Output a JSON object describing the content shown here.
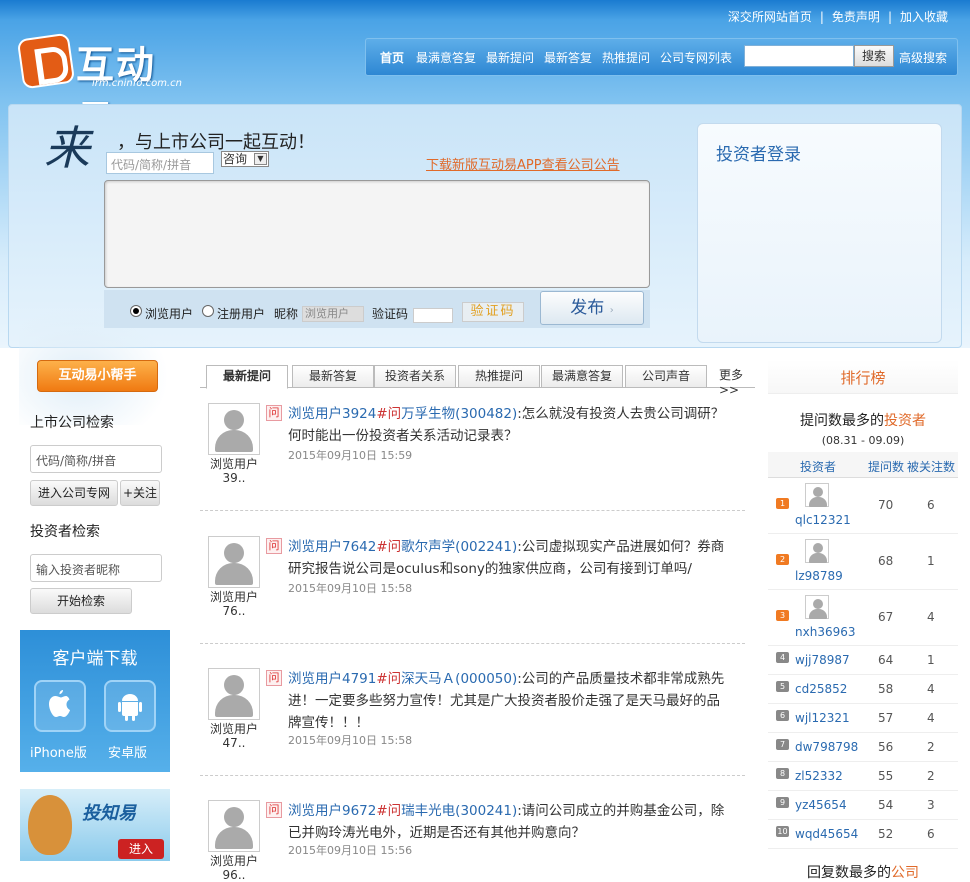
{
  "top_links": [
    "深交所网站首页",
    "免责声明",
    "加入收藏"
  ],
  "logo": {
    "name": "互动易",
    "url": "irm.cninfo.com.cn"
  },
  "nav": {
    "items": [
      "首页",
      "最满意答复",
      "最新提问",
      "最新答复",
      "热推提问",
      "公司专网列表"
    ],
    "search_button": "搜索",
    "advanced_search": "高级搜索"
  },
  "ask": {
    "lai": "来",
    "slogan": "，与上市公司一起互动！",
    "code_placeholder": "代码/简称/拼音",
    "type_value": "咨询",
    "app_link": "下载新版互动易APP查看公司公告",
    "radio_guest": "浏览用户",
    "radio_registered": "注册用户",
    "nick_label": "昵称",
    "nick_value": "浏览用户",
    "captcha_label": "验证码",
    "captcha_text": "验证码",
    "submit": "发布"
  },
  "login": {
    "title": "投资者登录"
  },
  "sidebar": {
    "helper": "互动易小帮手",
    "company_search_title": "上市公司检索",
    "company_placeholder": "代码/简称/拼音",
    "enter_button": "进入公司专网",
    "follow_button": "+关注",
    "investor_search_title": "投资者检索",
    "investor_placeholder": "输入投资者昵称",
    "start_search": "开始检索",
    "client_title": "客户端下载",
    "iphone": "iPhone版",
    "android": "安卓版",
    "touzhi_name": "投知易",
    "touzhi_enter": "进入"
  },
  "tabs": {
    "items": [
      "最新提问",
      "最新答复",
      "投资者关系",
      "热推提问",
      "最满意答复",
      "公司声音"
    ],
    "more": "更多>>"
  },
  "questions": [
    {
      "user": "浏览用户3924",
      "wen": "问",
      "company": "万孚生物(300482)",
      "text": ":怎么就没有投资人去贵公司调研？何时能出一份投资者关系活动记录表？",
      "time": "2015年09月10日 15:59",
      "avatar_user": "浏览用户",
      "avatar_sub": "39.."
    },
    {
      "user": "浏览用户7642",
      "wen": "问",
      "company": "歌尔声学(002241)",
      "text": ":公司虚拟现实产品进展如何？券商研究报告说公司是oculus和sony的独家供应商，公司有接到订单吗/",
      "time": "2015年09月10日 15:58",
      "avatar_user": "浏览用户",
      "avatar_sub": "76.."
    },
    {
      "user": "浏览用户4791",
      "wen": "问",
      "company": "深天马Ａ(000050)",
      "text": ":公司的产品质量技术都非常成熟先进！一定要多些努力宣传！尤其是广大投资者股价走强了是天马最好的品牌宣传！！！",
      "time": "2015年09月10日 15:58",
      "avatar_user": "浏览用户",
      "avatar_sub": "47.."
    },
    {
      "user": "浏览用户9672",
      "wen": "问",
      "company": "瑞丰光电(300241)",
      "text": ":请问公司成立的并购基金公司，除已并购玲涛光电外，近期是否还有其他并购意向？",
      "time": "2015年09月10日 15:56",
      "avatar_user": "浏览用户",
      "avatar_sub": "96.."
    }
  ],
  "ranking": {
    "title": "排行榜",
    "sub_prefix": "提问数最多的",
    "sub_highlight": "投资者",
    "date": "(08.31 - 09.09)",
    "col_investor": "投资者",
    "col_questions": "提问数",
    "col_follows": "被关注数",
    "rows": [
      {
        "rank": "1",
        "name": "qlc12321",
        "questions": "70",
        "follows": "6"
      },
      {
        "rank": "2",
        "name": "lz98789",
        "questions": "68",
        "follows": "1"
      },
      {
        "rank": "3",
        "name": "nxh36963",
        "questions": "67",
        "follows": "4"
      },
      {
        "rank": "4",
        "name": "wjj78987",
        "questions": "64",
        "follows": "1"
      },
      {
        "rank": "5",
        "name": "cd25852",
        "questions": "58",
        "follows": "4"
      },
      {
        "rank": "6",
        "name": "wjl12321",
        "questions": "57",
        "follows": "4"
      },
      {
        "rank": "7",
        "name": "dw798798",
        "questions": "56",
        "follows": "2"
      },
      {
        "rank": "8",
        "name": "zl52332",
        "questions": "55",
        "follows": "2"
      },
      {
        "rank": "9",
        "name": "yz45654",
        "questions": "54",
        "follows": "3"
      },
      {
        "rank": "10",
        "name": "wqd45654",
        "questions": "52",
        "follows": "6"
      }
    ],
    "reply_prefix": "回复数最多的",
    "reply_highlight": "公司"
  },
  "colors": {
    "accent": "#e06a2a",
    "link": "#2a6ab0",
    "rank_top": "#f07a22",
    "rank_other": "#888888"
  }
}
